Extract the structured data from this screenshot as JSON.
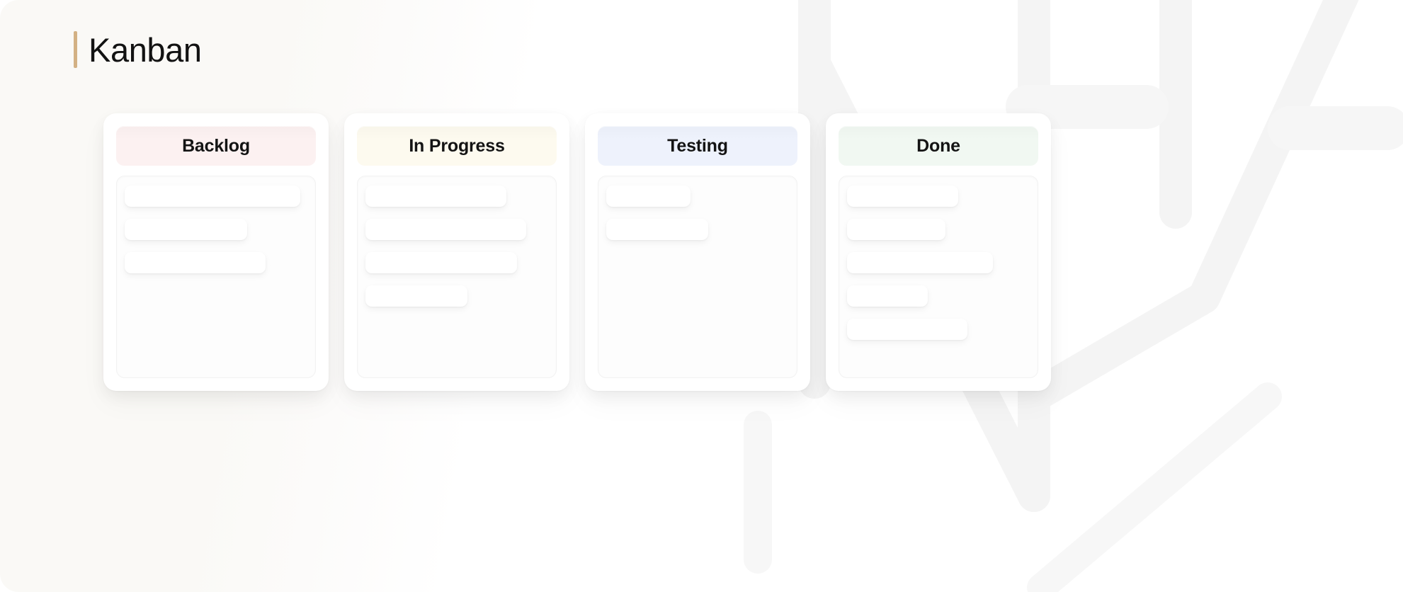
{
  "page": {
    "background_color": "#faf9f6",
    "accent_color": "#d3b184"
  },
  "header": {
    "title": "Kanban"
  },
  "board": {
    "columns": [
      {
        "name": "backlog",
        "label": "Backlog",
        "header_color": "#fcf1f1",
        "card_count": 3,
        "cards": [
          {
            "width_pct": 96
          },
          {
            "width_pct": 67
          },
          {
            "width_pct": 77
          }
        ]
      },
      {
        "name": "in-progress",
        "label": "In Progress",
        "header_color": "#fdfaef",
        "card_count": 4,
        "cards": [
          {
            "width_pct": 77
          },
          {
            "width_pct": 88
          },
          {
            "width_pct": 83
          },
          {
            "width_pct": 56
          }
        ]
      },
      {
        "name": "testing",
        "label": "Testing",
        "header_color": "#eef2fc",
        "card_count": 2,
        "cards": [
          {
            "width_pct": 46
          },
          {
            "width_pct": 56
          }
        ]
      },
      {
        "name": "done",
        "label": "Done",
        "header_color": "#f1f8f2",
        "card_count": 5,
        "cards": [
          {
            "width_pct": 61
          },
          {
            "width_pct": 54
          },
          {
            "width_pct": 80
          },
          {
            "width_pct": 44
          },
          {
            "width_pct": 66
          }
        ]
      }
    ]
  }
}
